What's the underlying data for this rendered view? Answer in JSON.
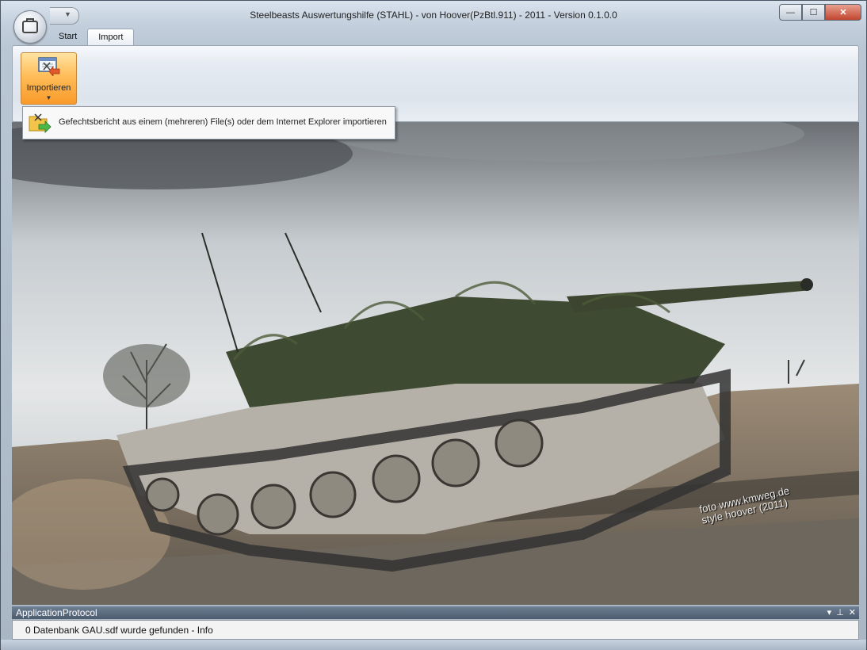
{
  "window": {
    "title": "Steelbeasts Auswertungshilfe (STAHL) - von Hoover(PzBtl.911) -  2011 - Version 0.1.0.0"
  },
  "tabs": [
    {
      "label": "Start"
    },
    {
      "label": "Import"
    }
  ],
  "ribbon": {
    "import_button": {
      "label": "Importieren"
    }
  },
  "dropdown": {
    "items": [
      {
        "label": "Gefechtsbericht aus einem (mehreren) File(s) oder dem Internet Explorer importieren",
        "icon": "import-folder-icon"
      }
    ]
  },
  "background_image": {
    "watermark_line1": "foto  www.kmweg.de",
    "watermark_line2": "style   hoover (2011)"
  },
  "protocol_panel": {
    "title": "ApplicationProtocol",
    "entries": [
      "0 Datenbank GAU.sdf wurde gefunden - Info"
    ]
  },
  "colors": {
    "ribbon_highlight": "#ffbd59",
    "panel_header": "#5d6c80",
    "close_button": "#c2452f"
  }
}
